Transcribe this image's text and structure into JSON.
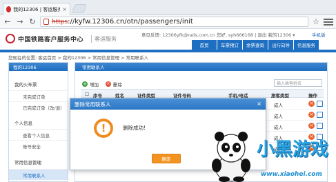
{
  "browser": {
    "tab_title": "我的12306 | 客运服务 | 铁",
    "url_scheme": "https",
    "url_text": "://kyfw.12306.cn/otn/passengers/init"
  },
  "header": {
    "site_name": "中国铁路客户服务中心",
    "sub_name": "客运服务",
    "top_links": "意见反馈: 12306yfk@rails.com.cn  您好, syh666168  |  退出    我的12306 ▾",
    "mobile_link": "手机版",
    "nav": [
      "首页",
      "车票预订",
      "余票查询",
      "出行向导",
      "信息服务"
    ]
  },
  "breadcrumb": "您现在的位置: 客运首页 > 我的12306 > 常用信息管理 > 常用联系人",
  "sidebar": {
    "title": "我的12306",
    "groups": [
      {
        "label": "我的火车票",
        "items": [
          "未完成订单",
          "已完成订单（改/退）"
        ]
      },
      {
        "label": "个人信息",
        "items": [
          "查看个人信息",
          "账号安全"
        ]
      },
      {
        "label": "常用信息管理",
        "items": [
          "常用联系人"
        ]
      }
    ]
  },
  "panel": {
    "title": "常用联系人",
    "add_label": "增加",
    "delete_label": "删除",
    "search_placeholder": "输入乘客姓名",
    "columns": [
      "序号",
      "姓名",
      "证件类型",
      "证件号码",
      "手机/电话",
      "旅客类型",
      "操作"
    ],
    "rows": [
      {
        "type": "成人"
      },
      {
        "type": "成人"
      },
      {
        "type": "成人"
      },
      {
        "type": "成人"
      },
      {
        "type": "成人"
      }
    ]
  },
  "modal": {
    "title": "删除常用联系人",
    "message": "删除成功!",
    "ok_label": "确定",
    "close_label": "×"
  },
  "watermark": {
    "text": "小黑游戏",
    "url": "www.xiaohei.com"
  }
}
